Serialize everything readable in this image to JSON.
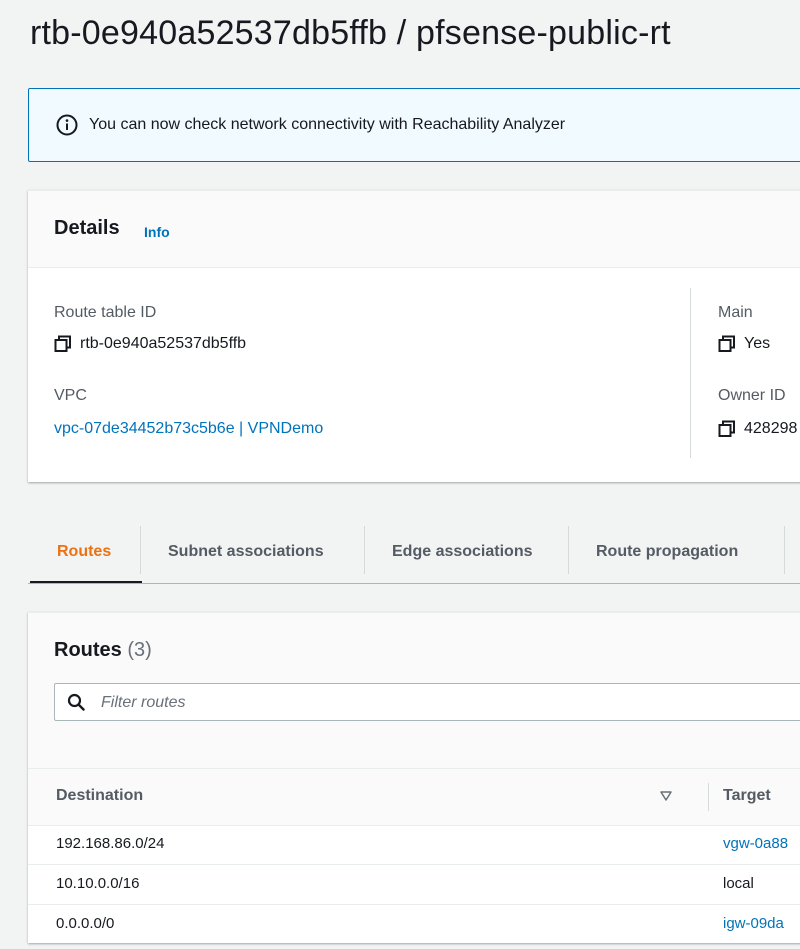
{
  "page_title": "rtb-0e940a52537db5ffb / pfsense-public-rt",
  "banner": {
    "icon": "info-circle-icon",
    "text": "You can now check network connectivity with Reachability Analyzer",
    "accent": "#0073bb"
  },
  "details": {
    "title": "Details",
    "info_link": "Info",
    "route_table_id_label": "Route table ID",
    "route_table_id_value": "rtb-0e940a52537db5ffb",
    "vpc_label": "VPC",
    "vpc_value": "vpc-07de34452b73c5b6e | VPNDemo",
    "main_label": "Main",
    "main_value": "Yes",
    "owner_id_label": "Owner ID",
    "owner_id_value": "428298"
  },
  "tabs": [
    {
      "label": "Routes",
      "active": true
    },
    {
      "label": "Subnet associations"
    },
    {
      "label": "Edge associations"
    },
    {
      "label": "Route propagation"
    }
  ],
  "routes": {
    "title": "Routes",
    "count": "(3)",
    "filter_placeholder": "Filter routes",
    "columns": {
      "destination": "Destination",
      "target": "Target"
    },
    "rows": [
      {
        "destination": "192.168.86.0/24",
        "target": "vgw-0a88",
        "target_is_link": true
      },
      {
        "destination": "10.10.0.0/16",
        "target": "local",
        "target_is_link": false
      },
      {
        "destination": "0.0.0.0/0",
        "target": "igw-09da",
        "target_is_link": true
      }
    ]
  },
  "colors": {
    "link": "#0073bb",
    "active_tab": "#ec7211",
    "background": "#f2f3f3"
  }
}
